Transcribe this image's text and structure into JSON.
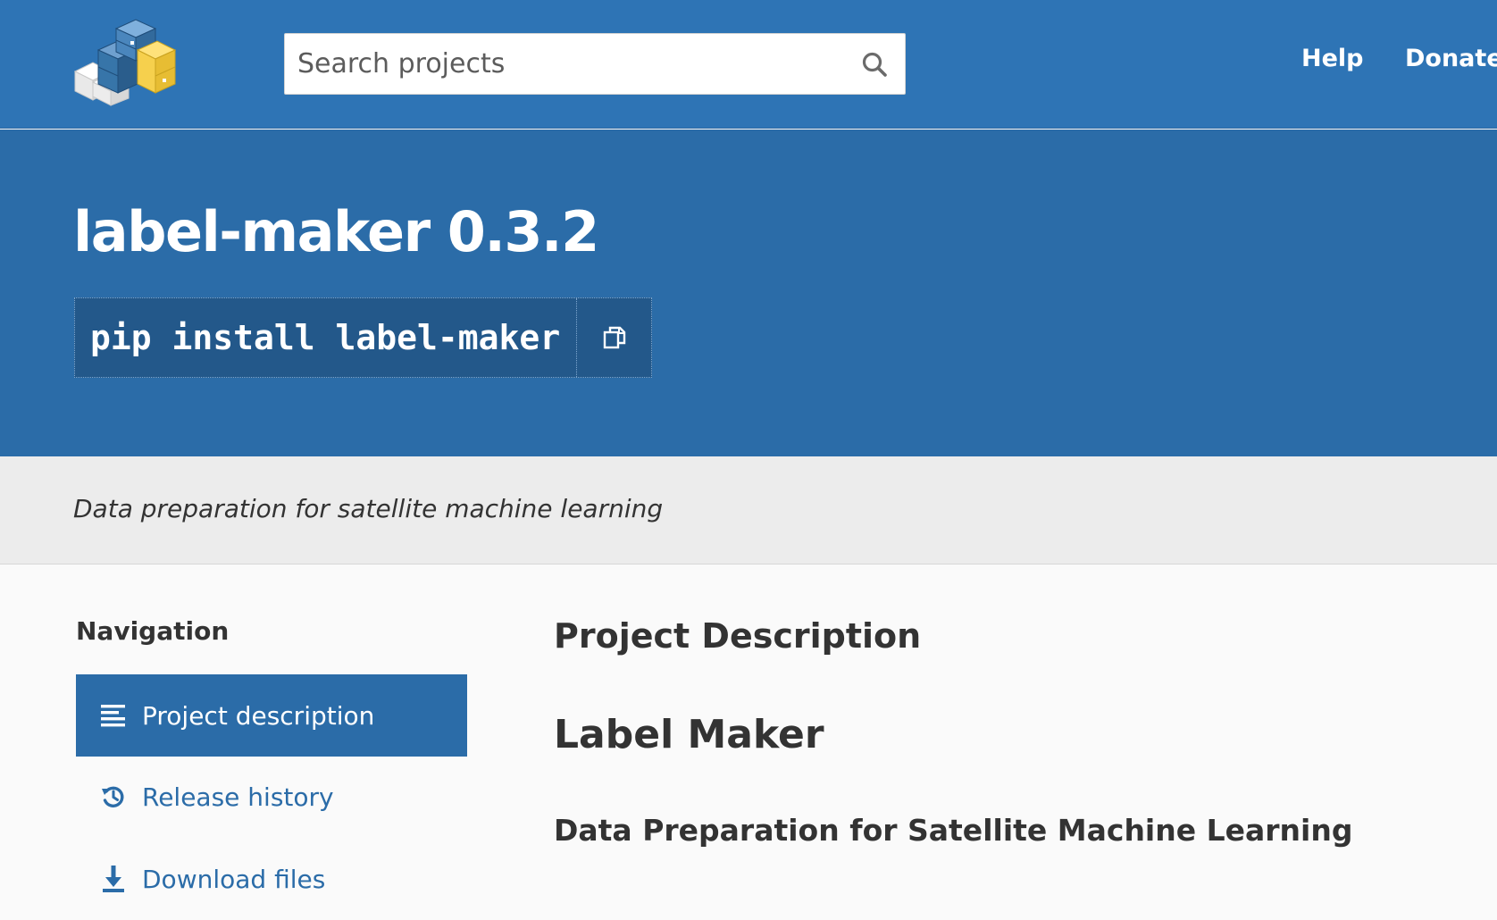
{
  "header": {
    "search": {
      "placeholder": "Search projects",
      "value": ""
    },
    "nav": [
      {
        "label": "Help"
      },
      {
        "label": "Donate"
      }
    ]
  },
  "package": {
    "title": "label-maker 0.3.2",
    "install_command": "pip install label-maker",
    "summary": "Data preparation for satellite machine learning"
  },
  "sidebar": {
    "heading": "Navigation",
    "items": [
      {
        "label": "Project description",
        "icon": "align-left-icon",
        "active": true
      },
      {
        "label": "Release history",
        "icon": "history-icon",
        "active": false
      },
      {
        "label": "Download files",
        "icon": "download-icon",
        "active": false
      }
    ]
  },
  "main": {
    "section_heading": "Project Description",
    "readme_title": "Label Maker",
    "readme_subtitle": "Data Preparation for Satellite Machine Learning"
  },
  "colors": {
    "header_blue": "#2e74b5",
    "banner_blue": "#2b6ca8",
    "summary_bg": "#ececec",
    "logo_yellow": "#f6d04d",
    "logo_blue": "#3775a9"
  }
}
